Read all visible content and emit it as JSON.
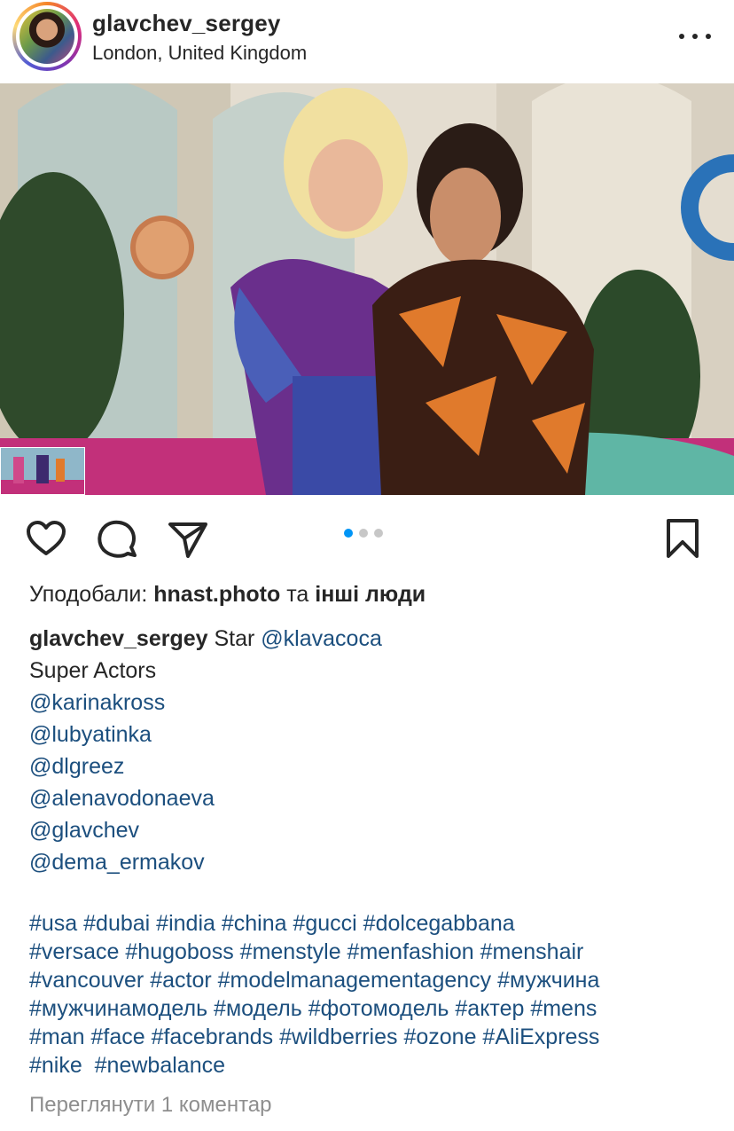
{
  "post": {
    "username": "glavchev_sergey",
    "location": "London, United Kingdom"
  },
  "icons": {
    "more": "more-horizontal-icon",
    "like": "heart-icon",
    "comment": "comment-icon",
    "share": "paper-plane-icon",
    "save": "bookmark-icon"
  },
  "carousel": {
    "count": 3,
    "active": 1
  },
  "likes": {
    "prefix": "Уподобали:",
    "user": "hnast.photo",
    "conjunction": "та",
    "others": "інші люди"
  },
  "caption": {
    "username": "glavchev_sergey",
    "first_text": "Star",
    "first_mention": "@klavacoca",
    "line2": "Super Actors",
    "mentions": [
      "@karinakross",
      "@lubyatinka",
      "@dlgreez",
      "@alenavodonaeva",
      "@glavchev",
      "@dema_ermakov"
    ],
    "hashtag_lines": [
      "#usa #dubai #india #china #gucci #dolcegabbana",
      "#versace #hugoboss #menstyle #menfashion #menshair",
      "#vancouver #actor #modelmanagementagency #мужчина",
      "#мужчинамодель #модель #фотомодель #актер #mens",
      "#man #face #facebrands #wildberries #ozone #AliExpress",
      "#nike  #newbalance"
    ]
  },
  "comments_link": "Переглянути 1 коментар",
  "colors": {
    "accent": "#0095f6",
    "link": "#1c4f7e",
    "muted": "#8e8e8e"
  }
}
